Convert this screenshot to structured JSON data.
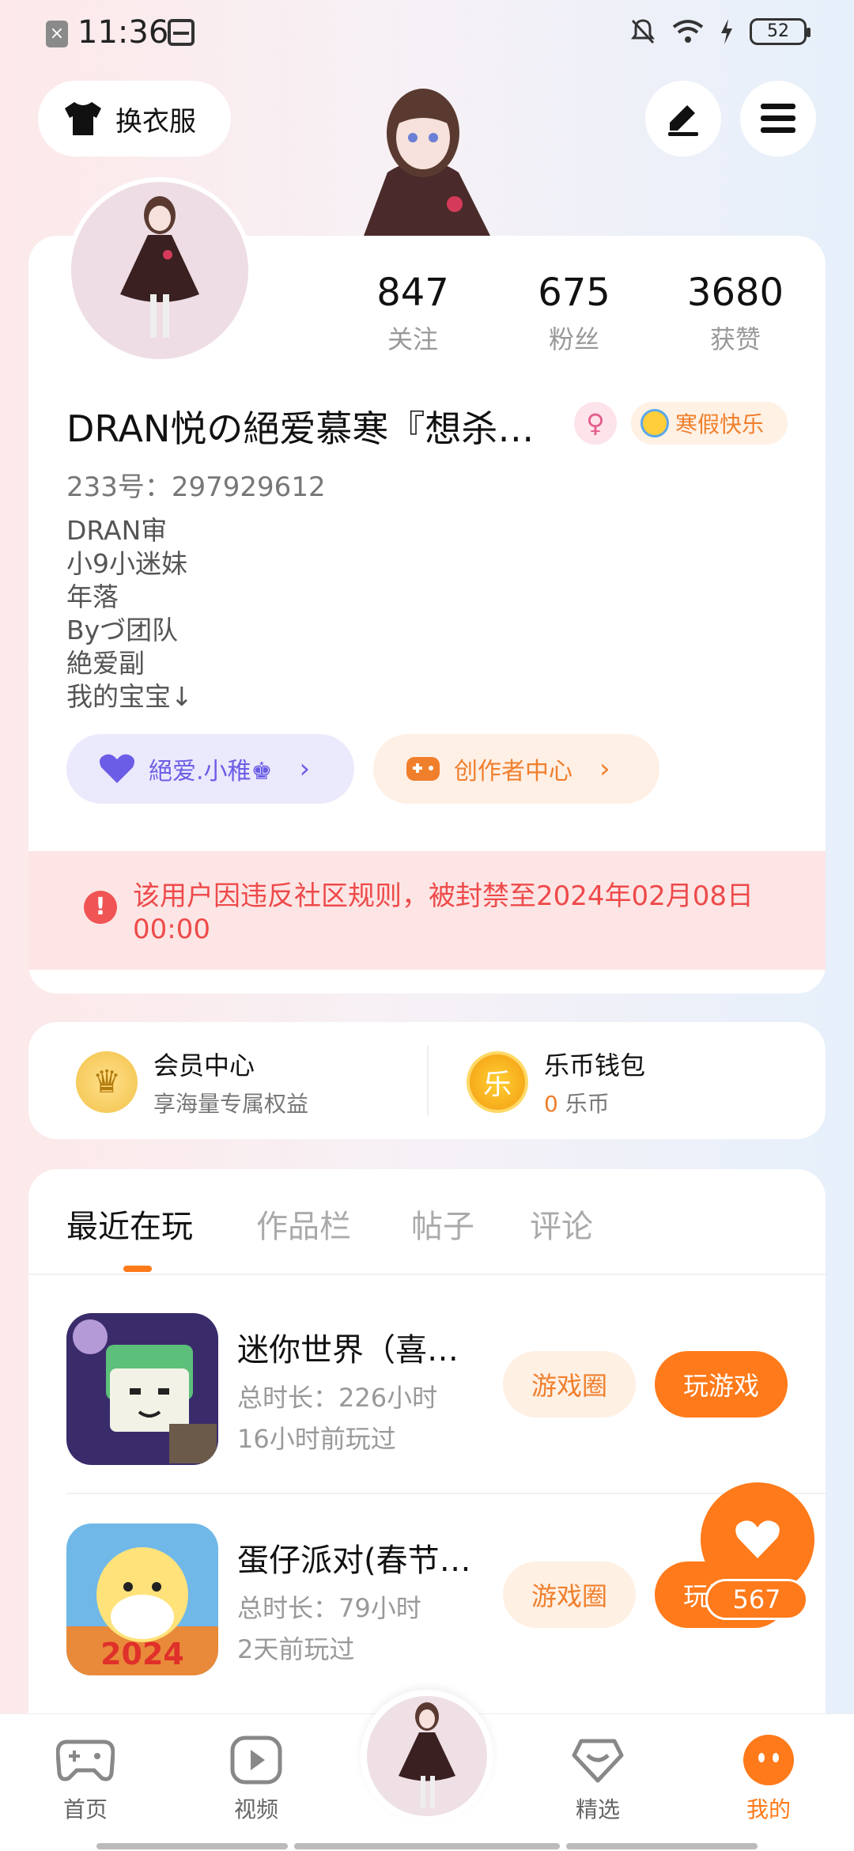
{
  "status_bar": {
    "time": "11:36",
    "battery": "52"
  },
  "top": {
    "outfit_label": "换衣服"
  },
  "profile": {
    "stats": [
      {
        "value": "847",
        "label": "关注"
      },
      {
        "value": "675",
        "label": "粉丝"
      },
      {
        "value": "3680",
        "label": "获赞"
      }
    ],
    "nickname": "DRAN悦の絕爱慕寒『想杀…",
    "event_badge": "寒假快乐",
    "uid": "233号：297929612",
    "bio": [
      "DRAN审",
      "小9小迷妹",
      "年落",
      "Byづ团队",
      "絶爱副",
      "我的宝宝↓"
    ],
    "club_label": "絕爱.小稚♚",
    "creator_label": "创作者中心",
    "ban_notice": "该用户因违反社区规则，被封禁至2024年02月08日 00:00"
  },
  "member": {
    "vip_title": "会员中心",
    "vip_sub": "享海量专属权益",
    "vip_icon": "crown-icon",
    "wallet_title": "乐币钱包",
    "wallet_amount": "0",
    "wallet_unit": "乐币",
    "wallet_icon_text": "乐"
  },
  "tabs": [
    "最近在玩",
    "作品栏",
    "帖子",
    "评论"
  ],
  "games": [
    {
      "title": "迷你世界（喜…",
      "duration": "总时长：226小时",
      "last_played": "16小时前玩过",
      "circle": "游戏圈",
      "play": "玩游戏"
    },
    {
      "title": "蛋仔派对(春节…",
      "duration": "总时长：79小时",
      "last_played": "2天前玩过",
      "circle": "游戏圈",
      "play": "玩游戏",
      "icon_badge": "2024"
    }
  ],
  "like": {
    "count": "567"
  },
  "nav": {
    "home": "首页",
    "video": "视频",
    "featured": "精选",
    "mine": "我的"
  },
  "colors": {
    "accent": "#ff7a1a",
    "danger": "#ee4a4a",
    "purple": "#6b5de6"
  }
}
